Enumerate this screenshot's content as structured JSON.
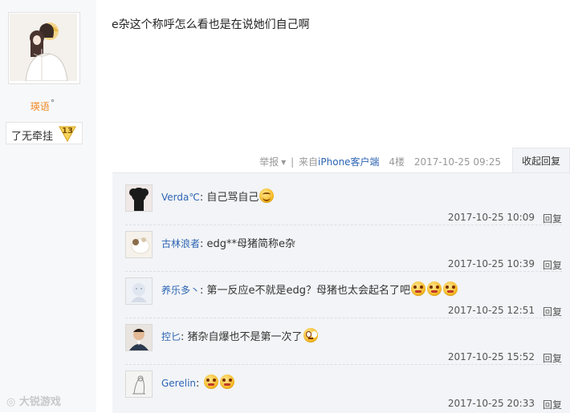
{
  "author": {
    "name": "瑛语",
    "name_suffix": "°",
    "level_title": "了无牵挂",
    "level_number": "13"
  },
  "post": {
    "content": "e杂这个称呼怎么看也是在说她们自己啊",
    "meta": {
      "report_label": "举报",
      "client_prefix": "来自",
      "client_name": "iPhone客户端",
      "floor": "4楼",
      "timestamp": "2017-10-25 09:25"
    },
    "collapse_label": "收起回复"
  },
  "replies": [
    {
      "user": "Verda℃",
      "text": "自己骂自己",
      "emoji": [
        "smile-emoji"
      ],
      "date": "2017-10-25 10:09",
      "reply_label": "回复"
    },
    {
      "user": "古林浪者",
      "text": "edg**母猪简称e杂",
      "emoji": [],
      "date": "2017-10-25 10:39",
      "reply_label": "回复"
    },
    {
      "user": "养乐多丶",
      "text": "第一反应e不就是edg？母猪也太会起名了吧",
      "emoji": [
        "angry-emoji",
        "angry-emoji",
        "angry-emoji"
      ],
      "date": "2017-10-25 12:51",
      "reply_label": "回复"
    },
    {
      "user": "控匕",
      "text": "猪杂自爆也不是第一次了",
      "emoji": [
        "eyeroll-emoji"
      ],
      "date": "2017-10-25 15:52",
      "reply_label": "回复"
    },
    {
      "user": "Gerelin",
      "text": "",
      "emoji": [
        "angry-emoji",
        "angry-emoji"
      ],
      "date": "2017-10-25 20:33",
      "reply_label": "回复"
    }
  ],
  "watermark": "大锐游戏",
  "colors": {
    "username_orange": "#f08a24",
    "link_blue": "#2d64b3",
    "reply_bg": "#f2f4f7"
  }
}
